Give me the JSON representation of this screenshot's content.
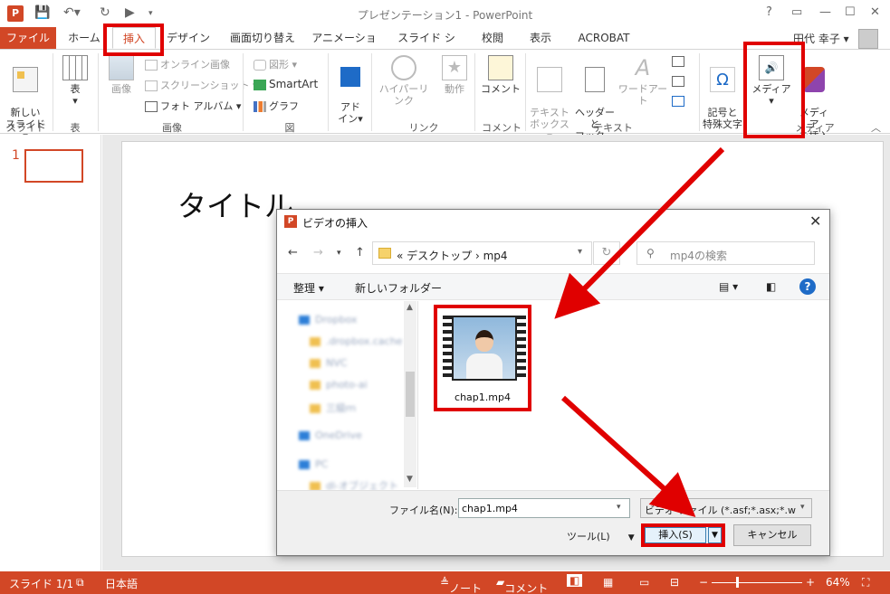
{
  "titlebar": {
    "app_icon": "P",
    "title": "プレゼンテーション1 - PowerPoint",
    "help": "?",
    "restore": "▭",
    "minimize": "—",
    "maximize": "☐",
    "close": "✕"
  },
  "tabs": {
    "file": "ファイル",
    "items": [
      "ホーム",
      "挿入",
      "デザイン",
      "画面切り替え",
      "アニメーション",
      "スライド ショー",
      "校閲",
      "表示",
      "ACROBAT"
    ],
    "active": "挿入",
    "user": "田代 幸子 ▾"
  },
  "ribbon": {
    "new_slide": "新しい\nスライド▾",
    "table": "表",
    "image": "画像",
    "online_image": "オンライン画像",
    "screenshot": "スクリーンショット",
    "photo_album": "フォト アルバム",
    "shapes": "図形",
    "smartart": "SmartArt",
    "graph": "グラフ",
    "addin": "アド\nイン▾",
    "hyperlink": "ハイパーリンク",
    "action": "動作",
    "comment": "コメント",
    "textbox": "テキスト\nボックス▾",
    "header_footer": "ヘッダーと\nフッター",
    "wordart": "ワードアート",
    "symbols": "記号と\n特殊文字",
    "media": "メディア",
    "media_insert": "メディア\nを挿入",
    "groups": {
      "slide": "スライド",
      "table": "表",
      "images": "画像",
      "illustrations": "図",
      "links": "リンク",
      "comments": "コメント",
      "text": "テキスト",
      "media": "メディア"
    }
  },
  "slide_pane": {
    "number": "1"
  },
  "slide": {
    "title": "タイトル"
  },
  "dialog": {
    "title": "ビデオの挿入",
    "path_prefix": "«",
    "path": "デスクトップ  ›  mp4",
    "search_placeholder": "mp4の検索",
    "organize": "整理 ▾",
    "new_folder": "新しいフォルダー",
    "nav_items": [
      {
        "label": "Dropbox",
        "type": "blue"
      },
      {
        "label": ".dropbox.cache",
        "type": "folder"
      },
      {
        "label": "NVC",
        "type": "folder"
      },
      {
        "label": "photo-ai",
        "type": "folder"
      },
      {
        "label": "三級ｍ",
        "type": "folder"
      },
      {
        "label": "OneDrive",
        "type": "blue"
      },
      {
        "label": "PC",
        "type": "blue"
      },
      {
        "label": "dl-オブジェクト",
        "type": "folder"
      }
    ],
    "file": {
      "name": "chap1.mp4"
    },
    "filename_label": "ファイル名(N):",
    "filename_value": "chap1.mp4",
    "filetype_value": "ビデオ ファイル (*.asf;*.asx;*.wpl;*.wm",
    "tools": "ツール(L)",
    "insert": "挿入(S)",
    "cancel": "キャンセル"
  },
  "statusbar": {
    "slide_count": "スライド 1/1",
    "language": "日本語",
    "notes": "ノート",
    "comments": "コメント",
    "minus": "−",
    "plus": "+",
    "zoom": "64%"
  },
  "colors": {
    "accent": "#d24726",
    "highlight": "#e00000"
  }
}
